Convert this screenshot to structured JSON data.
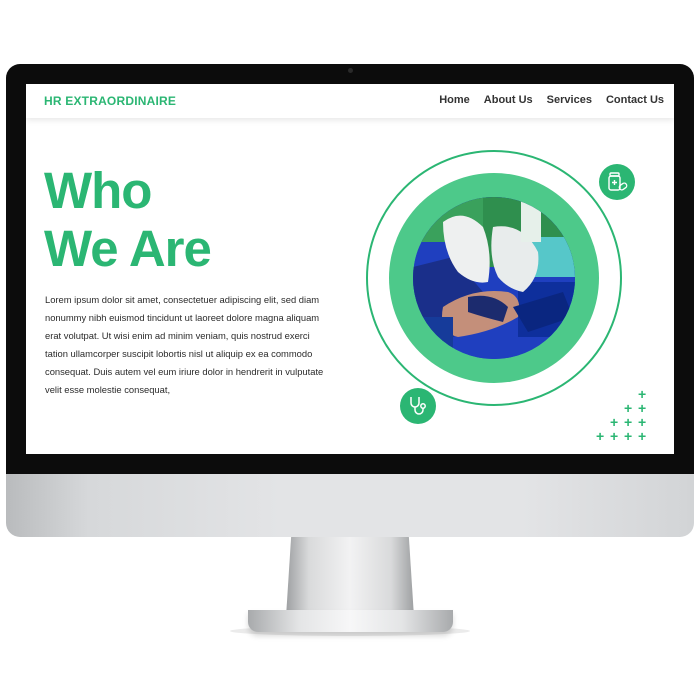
{
  "site": {
    "logo": "HR EXTRAORDINAIRE",
    "nav": [
      {
        "label": "Home"
      },
      {
        "label": "About Us"
      },
      {
        "label": "Services"
      },
      {
        "label": "Contact Us"
      }
    ]
  },
  "hero": {
    "title_line1": "Who",
    "title_line2": "We Are",
    "paragraph": "Lorem ipsum dolor sit amet, consectetuer adipiscing elit, sed diam nonummy nibh euismod tincidunt ut laoreet dolore magna aliquam erat volutpat. Ut wisi enim ad minim veniam, quis nostrud exerci tation ullamcorper suscipit lobortis nisl ut aliquip ex ea commodo consequat. Duis autem vel eum iriure dolor in hendrerit in vulputate velit esse molestie consequat,"
  },
  "icons": {
    "top_badge": "medicine-bottle-icon",
    "bottom_badge": "stethoscope-icon",
    "decoration": "plus-pattern"
  },
  "colors": {
    "brand_green": "#2bb673",
    "ring_green": "#4dc98a",
    "text_dark": "#2b2b2b"
  }
}
